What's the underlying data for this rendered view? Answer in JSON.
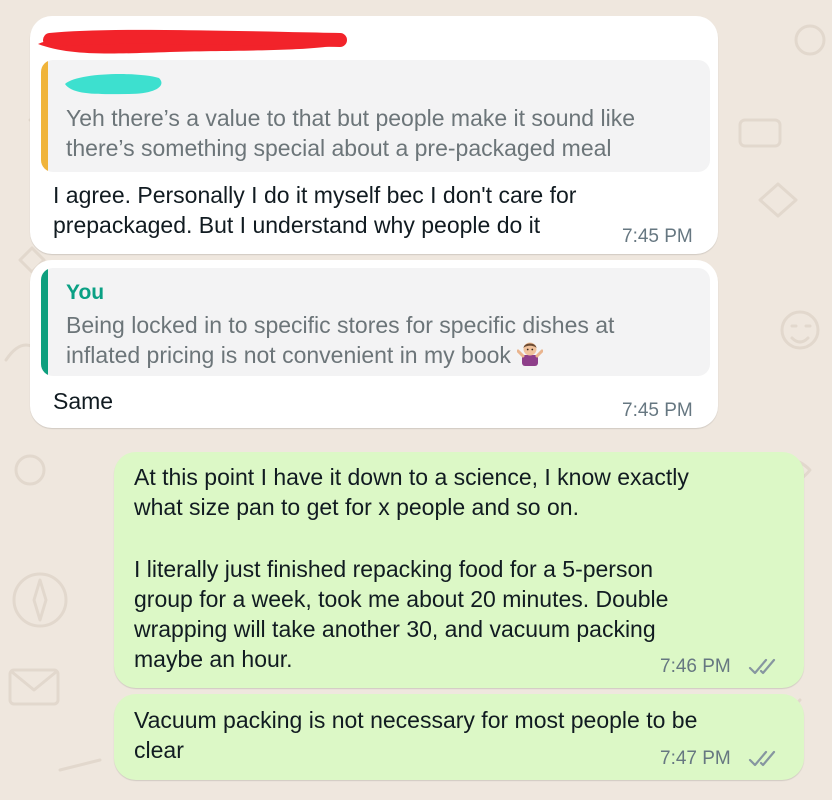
{
  "colors": {
    "background": "#efe7de",
    "incoming_bubble": "#ffffff",
    "outgoing_bubble": "#dcf8c6",
    "quote_bar_other": "#f0b43a",
    "quote_bar_you": "#0e9f7e",
    "redaction_red": "#f2232a",
    "redaction_teal": "#3de0cf",
    "tick_color": "#8696a0"
  },
  "messages": [
    {
      "direction": "incoming",
      "sender": "[redacted]",
      "quote": {
        "author": "[redacted]",
        "lines": [
          "Yeh there’s a value to that but people make it sound like",
          "there’s something special about a pre-packaged meal"
        ]
      },
      "lines": [
        "I agree. Personally I do it myself bec I don't care for",
        "prepackaged. But I understand why people do it"
      ],
      "time": "7:45 PM"
    },
    {
      "direction": "incoming",
      "quote": {
        "author": "You",
        "lines": [
          "Being locked in to specific stores for specific dishes at",
          "inflated pricing is not convenient in my book"
        ],
        "emoji": "person-shrugging"
      },
      "lines": [
        "Same"
      ],
      "time": "7:45 PM"
    },
    {
      "direction": "outgoing",
      "lines": [
        "At this point I have it down to a science, I know exactly",
        "what size pan to get for x people and so on.",
        "",
        "I literally just finished repacking food for a 5-person",
        "group for a week, took me about 20 minutes. Double",
        "wrapping will take another 30, and vacuum packing",
        "maybe an hour."
      ],
      "time": "7:46 PM",
      "status": "read-double-tick-icon"
    },
    {
      "direction": "outgoing",
      "lines": [
        "Vacuum packing is not necessary for most people to be",
        "clear"
      ],
      "time": "7:47 PM",
      "status": "read-double-tick-icon"
    }
  ]
}
